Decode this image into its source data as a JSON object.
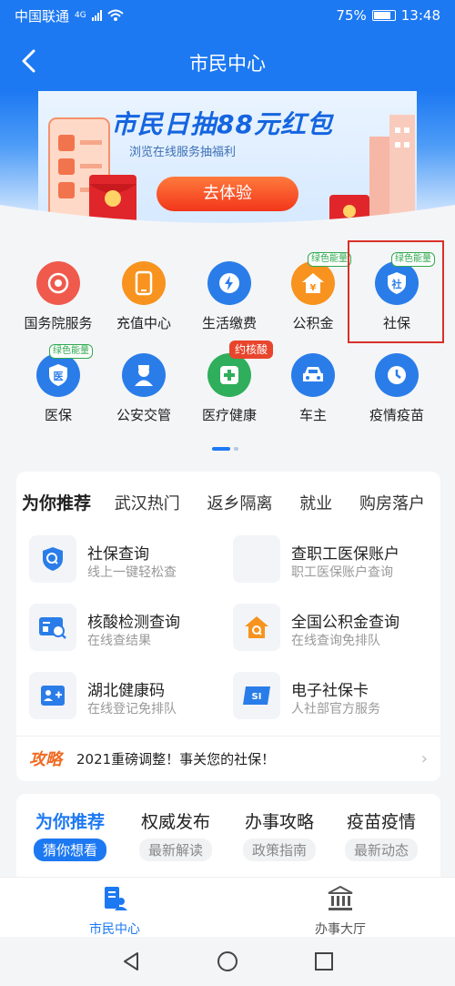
{
  "status_bar": {
    "carrier": "中国联通",
    "network": "4G",
    "battery": "75%",
    "time": "13:48"
  },
  "header": {
    "title": "市民中心"
  },
  "banner": {
    "title": "市民日抽88元红包",
    "subtitle": "浏览在线服务抽福利",
    "button": "去体验"
  },
  "services": [
    {
      "label": "国务院服务",
      "color": "#ef5a4d",
      "icon": "state-council-icon",
      "tag": ""
    },
    {
      "label": "充值中心",
      "color": "#f7931e",
      "icon": "phone-recharge-icon",
      "tag": ""
    },
    {
      "label": "生活缴费",
      "color": "#2a7de9",
      "icon": "lightning-icon",
      "tag": ""
    },
    {
      "label": "公积金",
      "color": "#f7931e",
      "icon": "housing-fund-icon",
      "tag": "绿色能量"
    },
    {
      "label": "社保",
      "color": "#2a7de9",
      "icon": "social-security-icon",
      "tag": "绿色能量",
      "glyph": "社"
    },
    {
      "label": "医保",
      "color": "#2a7de9",
      "icon": "medical-insurance-icon",
      "tag": "绿色能量",
      "glyph": "医"
    },
    {
      "label": "公安交管",
      "color": "#2a7de9",
      "icon": "police-icon",
      "tag": ""
    },
    {
      "label": "医疗健康",
      "color": "#2fae5c",
      "icon": "medical-cross-icon",
      "tag": "约核酸"
    },
    {
      "label": "车主",
      "color": "#2a7de9",
      "icon": "car-icon",
      "tag": ""
    },
    {
      "label": "疫情疫苗",
      "color": "#2a7de9",
      "icon": "vaccine-clock-icon",
      "tag": ""
    }
  ],
  "recommend": {
    "tabs": [
      "为你推荐",
      "武汉热门",
      "返乡隔离",
      "就业",
      "购房落户"
    ],
    "items": [
      {
        "title": "社保查询",
        "desc": "线上一键轻松查",
        "icon": "shield-search-icon"
      },
      {
        "title": "查职工医保账户",
        "desc": "职工医保账户查询",
        "icon": "blank-icon"
      },
      {
        "title": "核酸检测查询",
        "desc": "在线查结果",
        "icon": "test-result-icon"
      },
      {
        "title": "全国公积金查询",
        "desc": "在线查询免排队",
        "icon": "house-search-icon"
      },
      {
        "title": "湖北健康码",
        "desc": "在线登记免排队",
        "icon": "health-code-icon"
      },
      {
        "title": "电子社保卡",
        "desc": "人社部官方服务",
        "icon": "si-card-icon"
      }
    ],
    "strategy_label": "攻略",
    "strategy_text": "2021重磅调整！事关您的社保！"
  },
  "feed_tabs": [
    {
      "title": "为你推荐",
      "sub": "猜你想看"
    },
    {
      "title": "权威发布",
      "sub": "最新解读"
    },
    {
      "title": "办事攻略",
      "sub": "政策指南"
    },
    {
      "title": "疫苗疫情",
      "sub": "最新动态"
    }
  ],
  "bottom_nav": [
    {
      "label": "市民中心",
      "icon": "citizen-center-icon"
    },
    {
      "label": "办事大厅",
      "icon": "service-hall-icon"
    }
  ],
  "colors": {
    "primary": "#1d79f2",
    "highlight_border": "#d9302a",
    "green_tag": "#2fa84f"
  }
}
